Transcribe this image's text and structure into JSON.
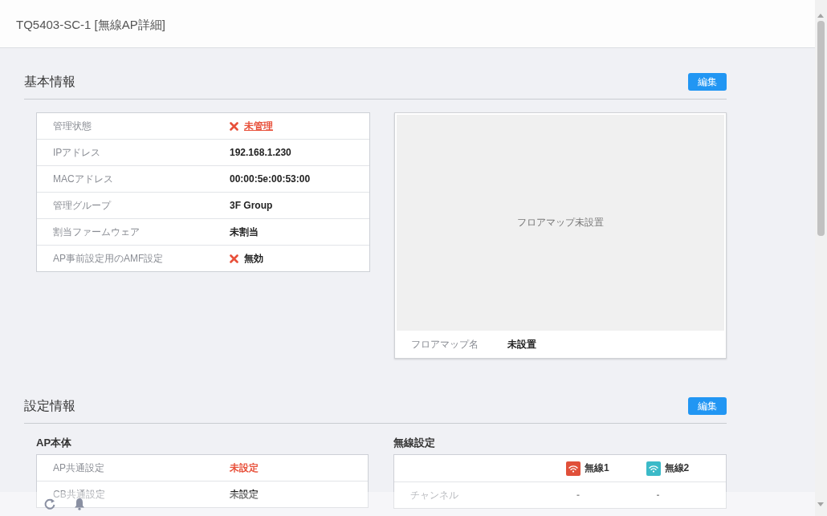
{
  "header": {
    "title": "TQ5403-SC-1 [無線AP詳細]"
  },
  "basic_info": {
    "title": "基本情報",
    "edit_button": "編集",
    "rows": [
      {
        "label": "管理状態",
        "value": "未管理",
        "kind": "cross-link"
      },
      {
        "label": "IPアドレス",
        "value": "192.168.1.230",
        "kind": "plain"
      },
      {
        "label": "MACアドレス",
        "value": "00:00:5e:00:53:00",
        "kind": "plain"
      },
      {
        "label": "管理グループ",
        "value": "3F Group",
        "kind": "plain"
      },
      {
        "label": "割当ファームウェア",
        "value": "未割当",
        "kind": "plain"
      },
      {
        "label": "AP事前設定用のAMF設定",
        "value": "無効",
        "kind": "cross"
      }
    ],
    "floor_map": {
      "placeholder_text": "フロアマップ未設置",
      "name_label": "フロアマップ名",
      "name_value": "未設置"
    }
  },
  "settings_info": {
    "title": "設定情報",
    "edit_button": "編集",
    "ap_body": {
      "title": "AP本体",
      "rows": [
        {
          "label": "AP共通設定",
          "value": "未設定",
          "kind": "alert"
        },
        {
          "label": "CB共通設定",
          "value": "未設定",
          "kind": "plain"
        }
      ]
    },
    "wireless": {
      "title": "無線設定",
      "columns": [
        {
          "label": "無線1",
          "color": "#e0503a"
        },
        {
          "label": "無線2",
          "color": "#3bbac8"
        }
      ],
      "rows": [
        {
          "label": "チャンネル",
          "values": [
            "-",
            "-"
          ]
        }
      ]
    }
  }
}
